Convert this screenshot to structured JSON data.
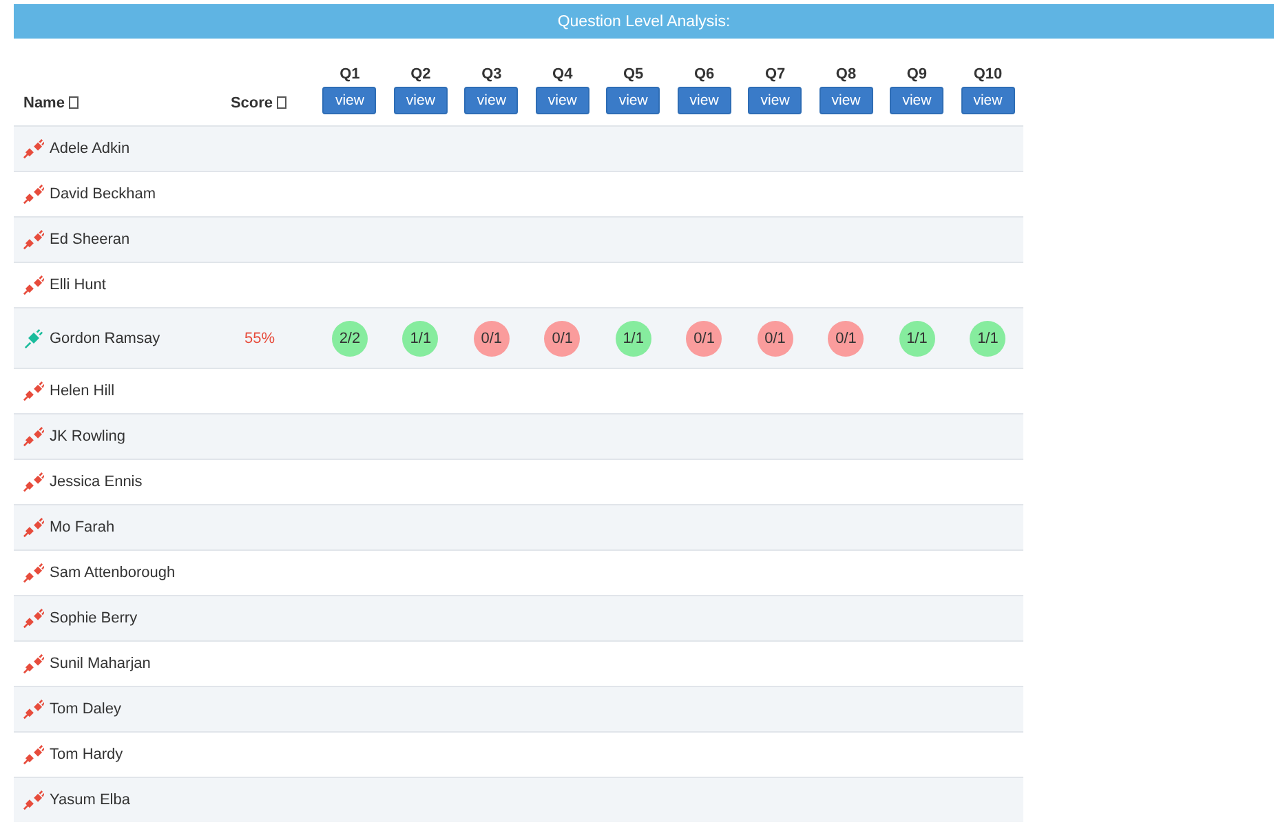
{
  "banner": {
    "title": "Question Level Analysis:"
  },
  "table": {
    "columns": [
      {
        "label": "Name",
        "sortable": true
      },
      {
        "label": "Score",
        "sortable": true
      }
    ],
    "questions": [
      {
        "label": "Q1",
        "button": "view"
      },
      {
        "label": "Q2",
        "button": "view"
      },
      {
        "label": "Q3",
        "button": "view"
      },
      {
        "label": "Q4",
        "button": "view"
      },
      {
        "label": "Q5",
        "button": "view"
      },
      {
        "label": "Q6",
        "button": "view"
      },
      {
        "label": "Q7",
        "button": "view"
      },
      {
        "label": "Q8",
        "button": "view"
      },
      {
        "label": "Q9",
        "button": "view"
      },
      {
        "label": "Q10",
        "button": "view"
      }
    ],
    "rows": [
      {
        "name": "Adele Adkin",
        "connected": false
      },
      {
        "name": "David Beckham",
        "connected": false
      },
      {
        "name": "Ed Sheeran",
        "connected": false
      },
      {
        "name": "Elli Hunt",
        "connected": false
      },
      {
        "name": "Gordon Ramsay",
        "connected": true,
        "score": "55%",
        "marks": [
          {
            "text": "2/2",
            "correct": true
          },
          {
            "text": "1/1",
            "correct": true
          },
          {
            "text": "0/1",
            "correct": false
          },
          {
            "text": "0/1",
            "correct": false
          },
          {
            "text": "1/1",
            "correct": true
          },
          {
            "text": "0/1",
            "correct": false
          },
          {
            "text": "0/1",
            "correct": false
          },
          {
            "text": "0/1",
            "correct": false
          },
          {
            "text": "1/1",
            "correct": true
          },
          {
            "text": "1/1",
            "correct": true
          }
        ]
      },
      {
        "name": "Helen Hill",
        "connected": false
      },
      {
        "name": "JK Rowling",
        "connected": false
      },
      {
        "name": "Jessica Ennis",
        "connected": false
      },
      {
        "name": "Mo Farah",
        "connected": false
      },
      {
        "name": "Sam Attenborough",
        "connected": false
      },
      {
        "name": "Sophie Berry",
        "connected": false
      },
      {
        "name": "Sunil Maharjan",
        "connected": false
      },
      {
        "name": "Tom Daley",
        "connected": false
      },
      {
        "name": "Tom Hardy",
        "connected": false
      },
      {
        "name": "Yasum Elba",
        "connected": false
      }
    ]
  }
}
